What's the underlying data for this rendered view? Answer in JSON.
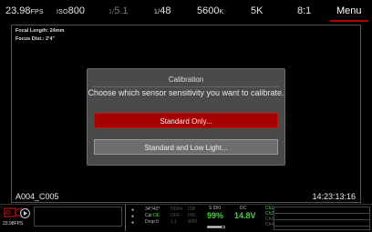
{
  "topbar": {
    "fps_value": "23.98",
    "fps_unit": "FPS",
    "iso_label": "ISO",
    "iso_value": "800",
    "shutter_prefix": "1/",
    "shutter_value": "5.1",
    "shutter_angle_prefix": "1/",
    "shutter_angle_value": "48",
    "white_balance_value": "5600",
    "white_balance_unit": "K",
    "resolution": "5K",
    "compression": "8:1",
    "menu_label": "Menu"
  },
  "lens": {
    "focal_length": "Focal Length: 24mm",
    "focus_distance": "Focus Dist.: 2'4\""
  },
  "clip_name": "A004_C005",
  "timecode": "14:23:13:16",
  "dialog": {
    "title": "Calibration",
    "message": "Choose which sensor sensitivity you want to calibrate.",
    "option_primary": "Standard Only...",
    "option_secondary": "Standard and Low Light..."
  },
  "bottombar": {
    "fps": "23.98FPS",
    "temp_value": "34°/42°",
    "cal_label": "Cal:",
    "cal_value": "OE",
    "drop_label": "Drop:",
    "drop_value": "0",
    "hdrx": "HDRx",
    "hdrx_state": "OFF",
    "ratio": "1:1",
    "isb": "ISB",
    "hig": "HIG",
    "wifi": "WIFI",
    "media_label": "S 550",
    "media_percent": "99%",
    "power_label": "DC",
    "voltage": "14.8V",
    "battery_level": 0.85,
    "channels": [
      {
        "label": "Ch1",
        "active": true
      },
      {
        "label": "Ch2",
        "active": true
      },
      {
        "label": "Ch3",
        "active": false
      },
      {
        "label": "Ch4",
        "active": false
      }
    ]
  },
  "colors": {
    "accent_red": "#a40000",
    "status_green": "#46d246",
    "dialog_bg": "#4a4a4a"
  }
}
